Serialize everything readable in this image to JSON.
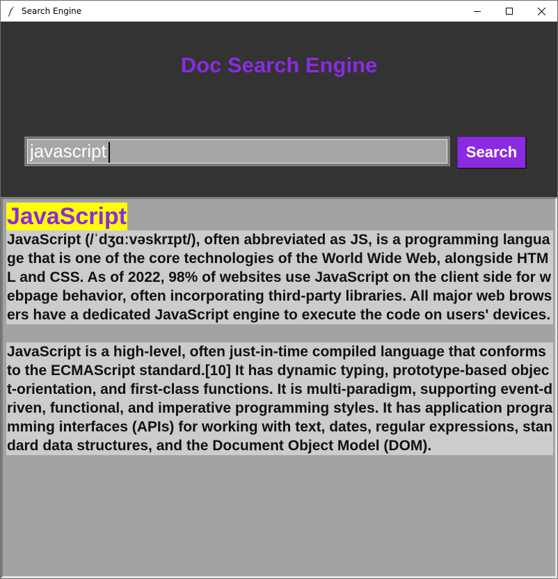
{
  "window": {
    "title": "Search Engine",
    "icon": "feather-icon",
    "controls": [
      "minimize-icon",
      "maximize-icon",
      "close-icon"
    ]
  },
  "header": {
    "title": "Doc Search Engine"
  },
  "search": {
    "value": "javascript",
    "button_label": "Search"
  },
  "result": {
    "title": "JavaScript",
    "paragraphs": [
      "JavaScript (/ˈdʒɑːvəskrɪpt/), often abbreviated as JS, is a programming language that is one of the core technologies of the World Wide Web, alongside HTML and CSS. As of 2022, 98% of websites use JavaScript on the client side for webpage behavior, often incorporating third-party libraries. All major web browsers have a dedicated JavaScript engine to execute the code on users' devices.",
      "JavaScript is a high-level, often just-in-time compiled language that conforms to the ECMAScript standard.[10] It has dynamic typing, prototype-based object-orientation, and first-class functions. It is multi-paradigm, supporting event-driven, functional, and imperative programming styles. It has application programming interfaces (APIs) for working with text, dates, regular expressions, standard data structures, and the Document Object Model (DOM)."
    ]
  },
  "colors": {
    "accent": "#8a2be2",
    "highlight": "#ffff00",
    "background": "#333333",
    "results_bg": "#a3a3a3",
    "paragraph_bg": "#cdcbcb"
  }
}
